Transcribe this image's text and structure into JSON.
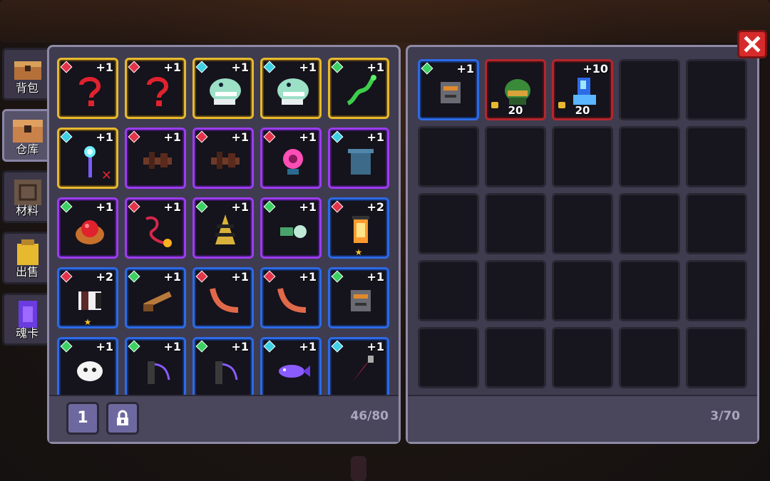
{
  "side_tabs": [
    {
      "label": "背包",
      "icon": "chest-icon",
      "active": false
    },
    {
      "label": "仓库",
      "icon": "storage-chest-icon",
      "active": true
    },
    {
      "label": "材料",
      "icon": "materials-box-icon",
      "active": false
    },
    {
      "label": "出售",
      "icon": "sell-bag-icon",
      "active": false
    },
    {
      "label": "魂卡",
      "icon": "soul-card-icon",
      "active": false
    }
  ],
  "storage": {
    "capacity": "46/80",
    "page_button": "1",
    "lock_button_icon": "lock-icon",
    "items": [
      {
        "icon": "red-question-hook",
        "rarity": "gold",
        "gem": "red",
        "plus": "+1"
      },
      {
        "icon": "red-question-hook",
        "rarity": "gold",
        "gem": "red",
        "plus": "+1"
      },
      {
        "icon": "bone-dragon-skull",
        "rarity": "gold",
        "gem": "cyan",
        "plus": "+1"
      },
      {
        "icon": "bone-dragon-skull",
        "rarity": "gold",
        "gem": "cyan",
        "plus": "+1"
      },
      {
        "icon": "green-serpent",
        "rarity": "gold",
        "gem": "green",
        "plus": "+1"
      },
      {
        "icon": "crystal-staff",
        "rarity": "gold",
        "gem": "cyan",
        "plus": "+1",
        "marked": true
      },
      {
        "icon": "crossbow",
        "rarity": "purple",
        "gem": "red",
        "plus": "+1"
      },
      {
        "icon": "crossbow",
        "rarity": "purple",
        "gem": "red",
        "plus": "+1"
      },
      {
        "icon": "pink-flower",
        "rarity": "purple",
        "gem": "red",
        "plus": "+1"
      },
      {
        "icon": "trash-can",
        "rarity": "purple",
        "gem": "cyan",
        "plus": "+1"
      },
      {
        "icon": "fruit-basket",
        "rarity": "purple",
        "gem": "green",
        "plus": "+1"
      },
      {
        "icon": "flame-whip",
        "rarity": "purple",
        "gem": "red",
        "plus": "+1"
      },
      {
        "icon": "striped-cone",
        "rarity": "purple",
        "gem": "green",
        "plus": "+1"
      },
      {
        "icon": "bubble-blaster",
        "rarity": "purple",
        "gem": "green",
        "plus": "+1"
      },
      {
        "icon": "lantern",
        "rarity": "blue",
        "gem": "red",
        "plus": "+2",
        "starred": true
      },
      {
        "icon": "iron-gauntlet",
        "rarity": "blue",
        "gem": "red",
        "plus": "+2",
        "starred": true
      },
      {
        "icon": "shotgun",
        "rarity": "blue",
        "gem": "green",
        "plus": "+1"
      },
      {
        "icon": "boomerang",
        "rarity": "blue",
        "gem": "red",
        "plus": "+1"
      },
      {
        "icon": "boomerang",
        "rarity": "blue",
        "gem": "red",
        "plus": "+1"
      },
      {
        "icon": "stone-totem",
        "rarity": "blue",
        "gem": "green",
        "plus": "+1"
      },
      {
        "icon": "white-ghost",
        "rarity": "blue",
        "gem": "green",
        "plus": "+1"
      },
      {
        "icon": "chain-whip",
        "rarity": "blue",
        "gem": "green",
        "plus": "+1"
      },
      {
        "icon": "chain-whip",
        "rarity": "blue",
        "gem": "green",
        "plus": "+1"
      },
      {
        "icon": "purple-fish",
        "rarity": "blue",
        "gem": "cyan",
        "plus": "+1"
      },
      {
        "icon": "red-drill",
        "rarity": "blue",
        "gem": "cyan",
        "plus": "+1"
      }
    ]
  },
  "backpack": {
    "capacity": "3/70",
    "items": [
      {
        "icon": "stone-totem",
        "rarity": "blue",
        "gem": "green",
        "plus": "+1"
      },
      {
        "icon": "green-helmet",
        "rarity": "red",
        "locked": true,
        "count": "20"
      },
      {
        "icon": "blue-crystal-boot",
        "rarity": "red",
        "locked": true,
        "plus": "+10",
        "count": "20"
      }
    ]
  },
  "close_icon": "close-x-icon"
}
